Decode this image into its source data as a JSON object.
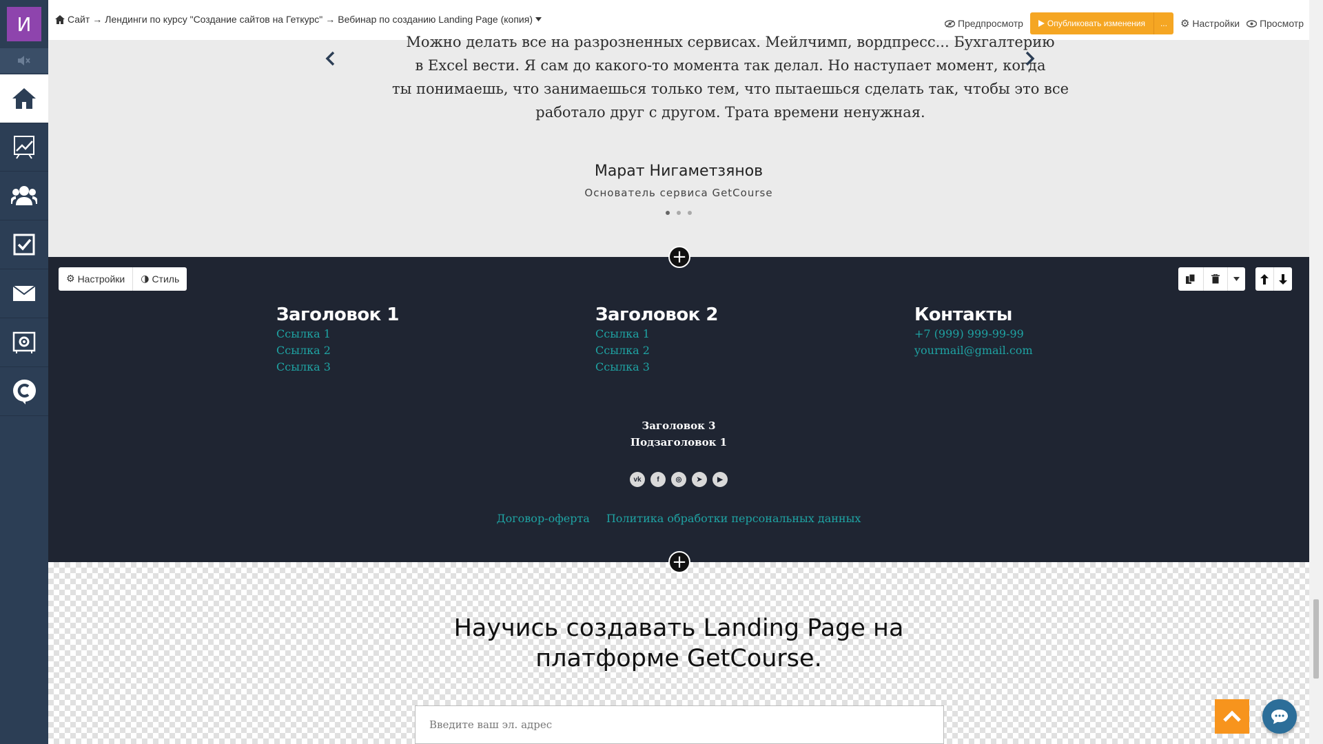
{
  "sidebar": {
    "avatar_letter": "И",
    "items": [
      "home-icon",
      "chart-icon",
      "users-icon",
      "tasks-icon",
      "mail-icon",
      "settings-icon",
      "getcourse-icon"
    ]
  },
  "topbar": {
    "breadcrumb": {
      "site": "Сайт",
      "arrow": "→",
      "section": "Лендинги по курсу \"Создание сайтов на Геткурс\"",
      "page": "Вебинар по созданию Landing Page (копия)"
    },
    "preview_label": "Предпросмотр",
    "publish_label": "Опубликовать изменения",
    "publish_more": "...",
    "settings_label": "Настройки",
    "view_label": "Просмотр"
  },
  "testimonial": {
    "quote_lines": [
      "Можно делать все на разрозненных сервисах. Мейлчимп, вордпресс... Бухгалтерию",
      "в Excel вести. Я сам до какого-то момента так делал. Но наступает момент, когда",
      "ты понимаешь, что занимаешься только тем, что пытаешься сделать так, чтобы это все",
      "работало друг с другом. Трата времени ненужная."
    ],
    "author": "Марат Нигаметзянов",
    "author_role": "Основатель сервиса GetCourse"
  },
  "block_toolbar": {
    "settings_label": "Настройки",
    "style_label": "Стиль"
  },
  "footer": {
    "col1": {
      "title": "Заголовок 1",
      "links": [
        "Ссылка 1",
        "Ссылка 2",
        "Ссылка 3"
      ]
    },
    "col2": {
      "title": "Заголовок 2",
      "links": [
        "Ссылка 1",
        "Ссылка 2",
        "Ссылка 3"
      ]
    },
    "col3": {
      "title": "Контакты",
      "phone": "+7 (999) 999-99-99",
      "email": "yourmail@gmail.com"
    },
    "heading3": "Заголовок 3",
    "subheading1": "Подзаголовок 1",
    "socials": [
      {
        "name": "vk-icon",
        "glyph": "vk"
      },
      {
        "name": "facebook-icon",
        "glyph": "f"
      },
      {
        "name": "instagram-icon",
        "glyph": "◎"
      },
      {
        "name": "telegram-icon",
        "glyph": "➤"
      },
      {
        "name": "youtube-icon",
        "glyph": "▶"
      }
    ],
    "offer_link": "Договор-оферта",
    "privacy_link": "Политика обработки персональных данных"
  },
  "signup": {
    "headline_line1": "Научись создавать Landing Page на",
    "headline_line2": "платформе GetCourse.",
    "email_placeholder": "Введите ваш эл. адрес"
  },
  "colors": {
    "sidebar": "#2c3e55",
    "avatar": "#8e44ad",
    "publish": "#f5a623",
    "footer_bg": "#1f2532",
    "link": "#1fa3a3",
    "up_button": "#f7941d"
  }
}
